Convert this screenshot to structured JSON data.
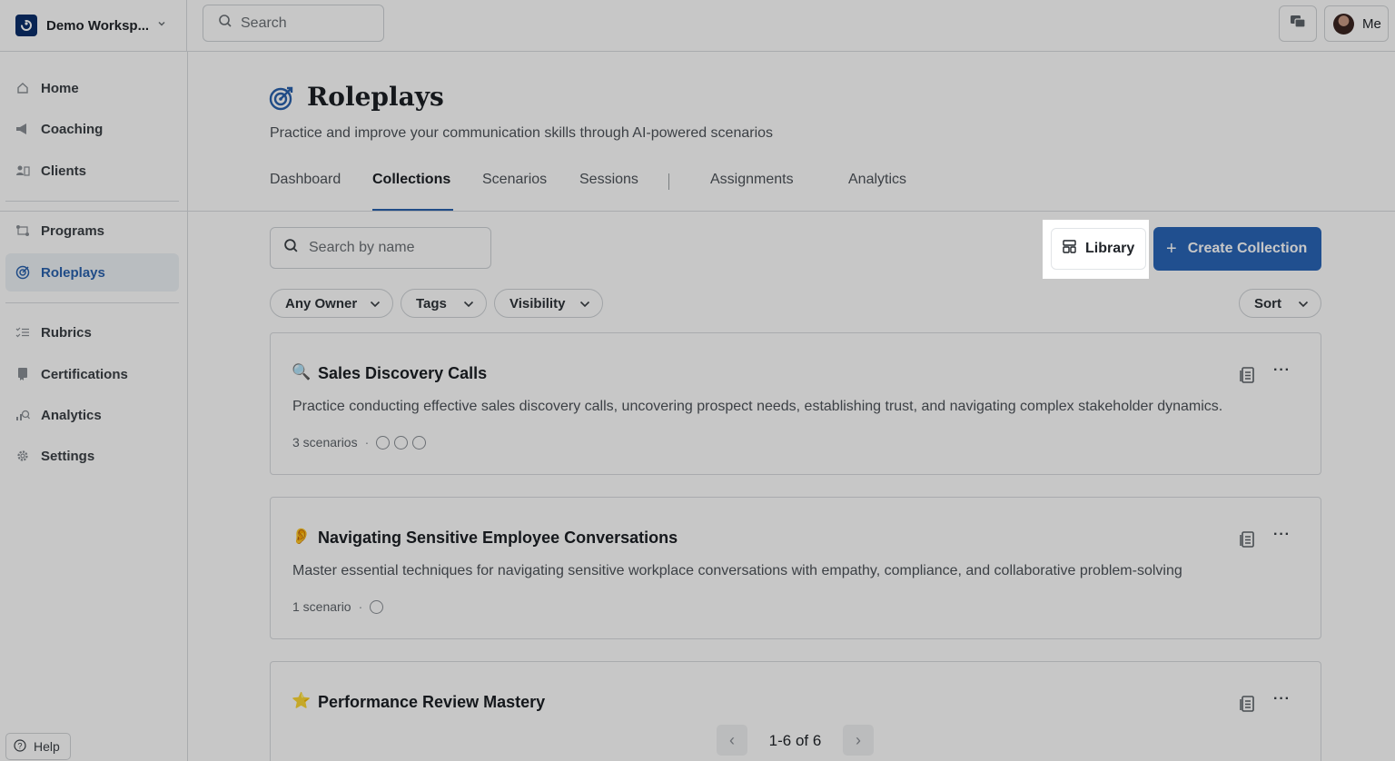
{
  "workspace": {
    "name": "Demo Worksp..."
  },
  "top_search": {
    "placeholder": "Search"
  },
  "user": {
    "label": "Me"
  },
  "sidebar": {
    "items": [
      {
        "label": "Home",
        "icon": "home-icon"
      },
      {
        "label": "Coaching",
        "icon": "megaphone-icon"
      },
      {
        "label": "Clients",
        "icon": "clients-icon"
      },
      {
        "label": "Programs",
        "icon": "programs-icon"
      },
      {
        "label": "Roleplays",
        "icon": "target-icon",
        "active": true
      },
      {
        "label": "Rubrics",
        "icon": "list-check-icon"
      },
      {
        "label": "Certifications",
        "icon": "certificate-icon"
      },
      {
        "label": "Analytics",
        "icon": "analytics-icon"
      },
      {
        "label": "Settings",
        "icon": "gear-icon"
      }
    ],
    "help_label": "Help"
  },
  "page": {
    "title": "Roleplays",
    "subtitle": "Practice and improve your communication skills through AI-powered scenarios"
  },
  "tabs": [
    {
      "label": "Dashboard"
    },
    {
      "label": "Collections",
      "active": true
    },
    {
      "label": "Scenarios"
    },
    {
      "label": "Sessions"
    },
    {
      "label": "Assignments"
    },
    {
      "label": "Analytics"
    }
  ],
  "toolbar": {
    "search_placeholder": "Search by name",
    "library_label": "Library",
    "create_label": "Create Collection"
  },
  "filters": [
    {
      "label": "Any Owner"
    },
    {
      "label": "Tags"
    },
    {
      "label": "Visibility"
    }
  ],
  "sort_label": "Sort",
  "collections": [
    {
      "emoji": "🔍",
      "title": "Sales Discovery Calls",
      "description": "Practice conducting effective sales discovery calls, uncovering prospect needs, establishing trust, and navigating complex stakeholder dynamics.",
      "meta": "3 scenarios",
      "scenario_count": 3
    },
    {
      "emoji": "👂",
      "title": "Navigating Sensitive Employee Conversations",
      "description": "Master essential techniques for navigating sensitive workplace conversations with empathy, compliance, and collaborative problem-solving",
      "meta": "1 scenario",
      "scenario_count": 1
    },
    {
      "emoji": "⭐",
      "title": "Performance Review Mastery",
      "description": "",
      "meta": ""
    }
  ],
  "pagination": {
    "label": "1-6 of 6"
  },
  "colors": {
    "accent": "#2a66b8",
    "active_nav": "#2a62ad",
    "overlay": "rgba(0,0,0,0.22)"
  }
}
